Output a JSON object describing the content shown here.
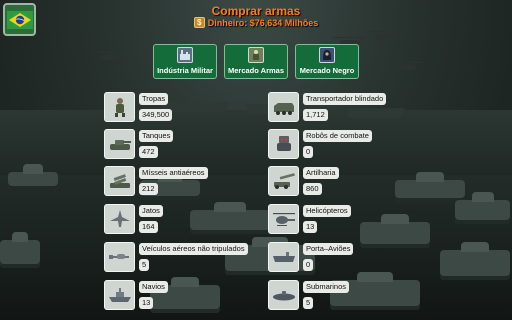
{
  "header": {
    "title": "Comprar armas",
    "money_icon_glyph": "$",
    "money": "Dinheiro: $76,634 Milhões"
  },
  "markets": [
    {
      "label": "Indústria Militar",
      "icon": "factory-icon"
    },
    {
      "label": "Mercado Armas",
      "icon": "soldier-icon"
    },
    {
      "label": "Mercado Negro",
      "icon": "hooded-figure-icon"
    }
  ],
  "weapons_left": [
    {
      "label": "Tropas",
      "count": "349,500",
      "icon": "soldier-icon"
    },
    {
      "label": "Tanques",
      "count": "472",
      "icon": "tank-icon"
    },
    {
      "label": "Mísseis antiaéreos",
      "count": "212",
      "icon": "missile-launcher-icon"
    },
    {
      "label": "Jatos",
      "count": "164",
      "icon": "jet-icon"
    },
    {
      "label": "Veículos aéreos não tripulados",
      "count": "5",
      "icon": "drone-icon"
    },
    {
      "label": "Navios",
      "count": "13",
      "icon": "warship-icon"
    }
  ],
  "weapons_right": [
    {
      "label": "Transportador blindado",
      "count": "1,712",
      "icon": "apc-icon"
    },
    {
      "label": "Robôs de combate",
      "count": "0",
      "icon": "robot-icon"
    },
    {
      "label": "Artilharia",
      "count": "860",
      "icon": "artillery-icon"
    },
    {
      "label": "Helicópteros",
      "count": "13",
      "icon": "helicopter-icon"
    },
    {
      "label": "Porta–Aviões",
      "count": "0",
      "icon": "aircraft-carrier-icon"
    },
    {
      "label": "Submarinos",
      "count": "5",
      "icon": "submarine-icon"
    }
  ],
  "colors": {
    "title": "#ff7a1a",
    "market_button": "#136c3a",
    "flag_green": "#2d9b3f",
    "flag_yellow": "#f2d21b",
    "flag_blue": "#1f3f8f"
  }
}
